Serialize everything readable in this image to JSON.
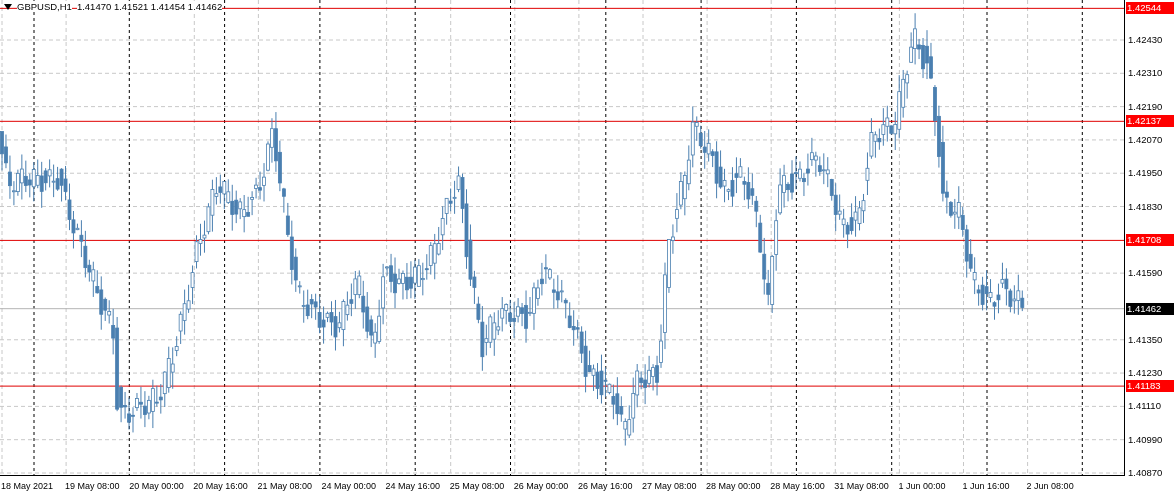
{
  "header": {
    "symbol": "GBPUSD,H1",
    "values": [
      "1.41470",
      "1.41521",
      "1.41454",
      "1.41462"
    ]
  },
  "price_axis": [
    "1.42430",
    "1.42310",
    "1.42190",
    "1.42070",
    "1.41950",
    "1.41830",
    "1.41590",
    "1.41350",
    "1.41230",
    "1.41110",
    "1.40990",
    "1.40870"
  ],
  "price_lines": [
    {
      "label": "1.42544",
      "kind": "level"
    },
    {
      "label": "1.42137",
      "kind": "level"
    },
    {
      "label": "1.41708",
      "kind": "level"
    },
    {
      "label": "1.41462",
      "kind": "bid"
    },
    {
      "label": "1.41183",
      "kind": "level"
    }
  ],
  "time_axis": [
    "18 May 2021",
    "19 May 08:00",
    "20 May 00:00",
    "20 May 16:00",
    "21 May 08:00",
    "24 May 00:00",
    "24 May 16:00",
    "25 May 08:00",
    "26 May 00:00",
    "26 May 16:00",
    "27 May 08:00",
    "28 May 00:00",
    "28 May 16:00",
    "31 May 08:00",
    "1 Jun 00:00",
    "1 Jun 16:00",
    "2 Jun 08:00"
  ]
}
